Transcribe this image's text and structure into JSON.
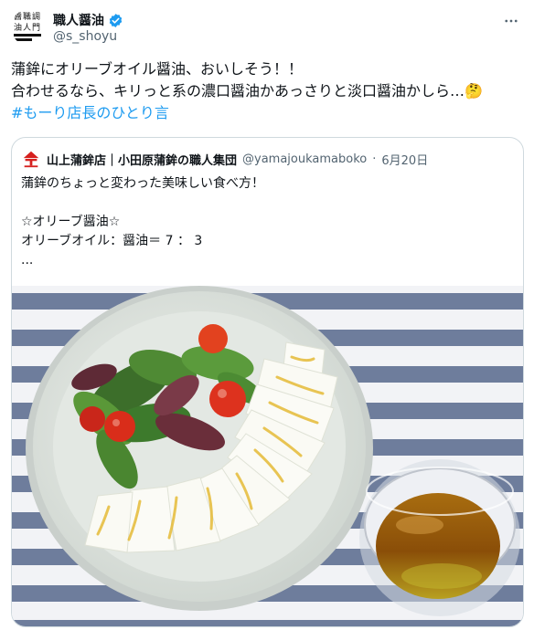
{
  "author": {
    "display_name": "職人醤油",
    "handle": "@s_shoyu",
    "avatar_text": "職人醤油",
    "verified_icon": "verified-badge-icon"
  },
  "more_icon": "more-icon",
  "tweet": {
    "line1": "蒲鉾にオリーブオイル醤油、おいしそう！！",
    "line2": "合わせるなら、キリっと系の濃口醤油かあっさりと淡口醤油かしら…🤔",
    "hashtag": "#もーり店長のひとり言"
  },
  "quote": {
    "display_name": "山上蒲鉾店｜小田原蒲鉾の職人集団",
    "handle": "@yamajoukamaboko",
    "separator": "·",
    "date": "6月20日",
    "lines": [
      "蒲鉾のちょっと変わった美味しい食べ方！",
      "",
      "☆オリーブ醤油☆",
      "オリーブオイル：醤油＝ 7 ： 3",
      "..."
    ],
    "logo_icon": "yamajou-logo-icon"
  },
  "colors": {
    "hashtag": "#1d9bf0",
    "verified": "#1d9bf0",
    "muted": "#536471",
    "border": "#cfd9de"
  }
}
